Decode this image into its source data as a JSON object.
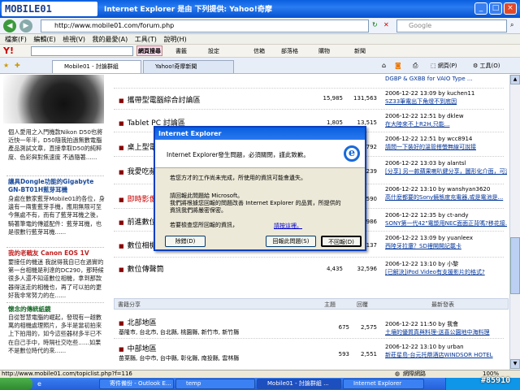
{
  "window": {
    "logo_text": "MOBILE01",
    "title": "Internet Explorer 是由 下列提供: Yahoo!奇摩"
  },
  "addressbar": {
    "url": "http://www.mobile01.com/forum.php",
    "search_placeholder": "Google"
  },
  "menu": [
    "檔案(F)",
    "編輯(E)",
    "檢視(V)",
    "我的最愛(A)",
    "工具(T)",
    "說明(H)"
  ],
  "yahoo_toolbar": {
    "logo": "Y!",
    "search_button": "網頁搜尋",
    "items": [
      "書籤",
      "設定",
      "信箱",
      "部落格",
      "購物",
      "新聞"
    ]
  },
  "tabs": [
    {
      "label": "Mobile01 - 討論群組"
    },
    {
      "label": "Yahoo!奇摩新聞"
    }
  ],
  "left_column": {
    "block1": "個人愛用之入門機款Nikon D50也將近快一年半，D50隨我拍過無數電腦產品測試文章，直接拿取D50的純粹度、色彩與對焦速度 不過隨著......",
    "head2": "讓具Dongle功能的Gigabyte GN-BT01H藍芽耳機",
    "block2": "身處在數家藍芽Mobile01的各位，身邊有一兩隻藍芽手機，應用無限可至今無處不有，而有了藍芽耳機之後，騎著筆電的傳遞配件：藍芽耳機，也是很數行藍芽耳機......",
    "head3": "我的老戰友 Canon EOS 1V",
    "block3": "要接任的機迷 我說得我自已在過實的第一台相機是利達的DC290，那時候很多人還不知道數位相機，拿到那款器得送走的相機也，再了可以拍的更好我非常努力的在......",
    "head4": "懷念的傳統紙鏡",
    "block4": "自從智慧電腦的崛起，發現有一越數萬的相機處理照片，多半是當初拍來上下拍用的，如今這些器材多半已不在自己手中，時隔社交吃些......如果不是數位時代的來......"
  },
  "forums": [
    {
      "name": "攜帶型電腦綜合討論區",
      "topics": "15,985",
      "posts": "131,563",
      "last_time": "2006-12-22 13:09 by kuchen11",
      "last_title": "SZ33筆電出下角燈不到底因"
    },
    {
      "name": "Tablet PC 討論區",
      "topics": "1,805",
      "posts": "13,515",
      "last_time": "2006-12-22 12:51 by dklew",
      "last_title": "在大陸來不上R2H,只能..."
    },
    {
      "name": "桌上型電腦",
      "topics": "",
      "posts": "3,792",
      "last_time": "2006-12-22 12:51 by wcc8914",
      "last_title": "請問一下裝好的溫管搭螢無線可說接"
    },
    {
      "name": "我愛吃蘋果",
      "topics": "",
      "posts": "4,239",
      "last_time": "2006-12-22 13:03 by alantsl",
      "last_title": "[分享] 另一款蘋果喇叭鍵分享，圖形化介面，可過段..."
    },
    {
      "name": "即時影像",
      "topics": "",
      "posts": "5,590",
      "last_time": "2006-12-22 13:10 by wanshyan3620",
      "last_title": "高什麼都要的Sony鏡態度充電器,或是電池是..."
    },
    {
      "name": "前進數位家",
      "topics": "",
      "posts": "8,986",
      "last_time": "2006-12-22 12:35 by ct-andy",
      "last_title": "SONY第一代42\"電漿用NEC面面正背嗎?移花接..."
    },
    {
      "name": "數位相機綜",
      "topics": "",
      "posts": "11,137",
      "last_time": "2006-12-22 13:09 by yuanleex",
      "last_title": "西陸牙拉還？SD裡開開記載卡"
    },
    {
      "name": "數位傳聲筒",
      "topics": "4,435",
      "posts": "32,596",
      "last_time": "2006-12-22 13:10 by 小黎",
      "last_title": "[已解決]iPod Video有支援影片的格式?"
    }
  ],
  "section_header": {
    "forum": "書籍分享",
    "topics": "主題",
    "posts": "回覆",
    "last": "最新發表"
  },
  "regions": [
    {
      "name": "北部地區",
      "sub": "基隆市, 台北市, 台北縣, 桃園縣, 新竹市, 新竹縣",
      "topics": "675",
      "posts": "2,575",
      "last_time": "2006-12-22 11:50 by 我會",
      "last_title": "土壤的優質真與料理-送喜公園地中海料理"
    },
    {
      "name": "中部地區",
      "sub": "苗栗縣, 台中市, 台中縣, 彰化縣, 南投縣, 雲林縣",
      "topics": "593",
      "posts": "2,551",
      "last_time": "2006-12-22 13:10 by urban",
      "last_title": "新莊星島-台元托鼎酒店WINDSOR HOTEL"
    }
  ],
  "top_partial": "DGBP & GXBB for VAIO Type ...",
  "dialog": {
    "title": "Internet Explorer",
    "message": "Internet Explorer發生問題，必須關閉，謹此致歉。",
    "lines1": "若您方才的工作尚未完成，所使用的資訊可能會遺失。",
    "lines2a": "請回報此問題給 Microsoft。",
    "lines2b": "我們將根據您回報的問題改善 Internet Explorer 的品質，所提供的",
    "lines2c": "資訊我們將嚴密保密。",
    "lines3": "若要檢查您所回報的資訊，",
    "link": "請按這裡。",
    "btn_debug": "除錯(D)",
    "btn_send": "回報此問題(S)",
    "btn_nosend": "不回報(D)"
  },
  "statusbar": {
    "url": "http://www.mobile01.com/topiclist.php?f=116",
    "zone": "網際網路",
    "zoom": "100%"
  },
  "taskbar": {
    "items": [
      "寄件備份 - Outlook E...",
      "temp",
      "Mobile01 - 討論群組 ...",
      "Internet Explorer"
    ],
    "watermark": "#85910"
  }
}
